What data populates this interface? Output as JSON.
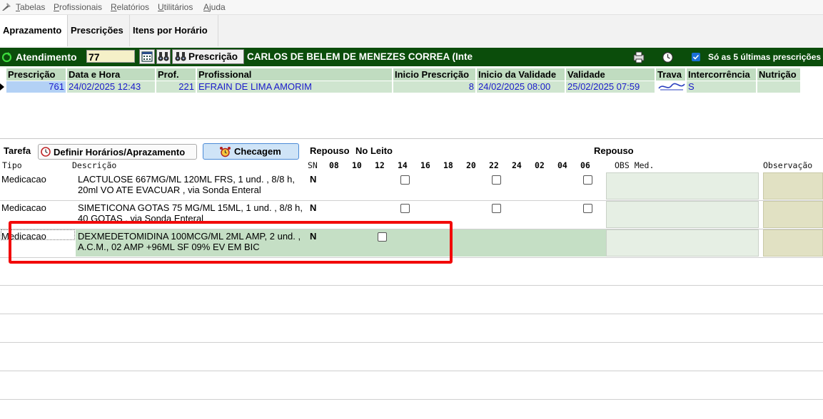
{
  "menu": [
    "Tabelas",
    "Profissionais",
    "Relatórios",
    "Utilitários",
    "Ajuda"
  ],
  "tabs": [
    "Aprazamento",
    "Prescrições",
    "Itens por Horário"
  ],
  "atendimento": {
    "label": "Atendimento",
    "number": "77",
    "prescricao_button": "Prescrição",
    "patient": "CARLOS DE BELEM DE MENEZES CORREA (Inte",
    "only5_label": "Só as 5 últimas prescrições"
  },
  "presc_grid": {
    "headers": [
      "Prescrição",
      "Data e Hora",
      "Prof.",
      "Profissional",
      "Inicio Prescrição",
      "Inicio da Validade",
      "Validade",
      "Trava",
      "Intercorrência",
      "Nutrição"
    ],
    "row": {
      "prescricao": "761",
      "data_hora": "24/02/2025 12:43",
      "prof": "221",
      "profissional": "EFRAIN DE LIMA AMORIM",
      "inicio_prescricao": "8",
      "inicio_validade": "24/02/2025 08:00",
      "validade": "25/02/2025 07:59",
      "intercorrencia": "S"
    }
  },
  "task": {
    "label": "Tarefa",
    "definir_button": "Definir Horários/Aprazamento",
    "checagem_button": "Checagem",
    "repouso_left": "Repouso",
    "no_leito": "No Leito",
    "repouso_right": "Repouso"
  },
  "items_grid": {
    "col_tipo": "Tipo",
    "col_descricao": "Descrição",
    "col_sn": "SN",
    "hours": [
      "08",
      "10",
      "12",
      "14",
      "16",
      "18",
      "20",
      "22",
      "24",
      "02",
      "04",
      "06"
    ],
    "col_obs_med": "OBS Med.",
    "col_observacao": "Observação",
    "rows": [
      {
        "tipo": "Medicacao",
        "descricao": "LACTULOSE 667MG/ML 120ML FRS, 1 und. , 8/8 h, 20ml VO ATE EVACUAR , via Sonda Enteral",
        "sn": "N"
      },
      {
        "tipo": "Medicacao",
        "descricao": "SIMETICONA GOTAS 75 MG/ML 15ML, 1 und. , 8/8 h, 40 GOTAS , via Sonda Enteral",
        "sn": "N"
      },
      {
        "tipo": "Medicacao",
        "descricao": "DEXMEDETOMIDINA 100MCG/ML 2ML AMP, 2 und. , A.C.M., 02 AMP +96ML SF 09% EV EM BIC",
        "sn": "N"
      }
    ]
  },
  "colors": {
    "header_green": "#0b4d0b",
    "grid_green": "#c0dcc0",
    "highlight": "#f20a0a",
    "selected_cell": "#b3d1f5"
  }
}
